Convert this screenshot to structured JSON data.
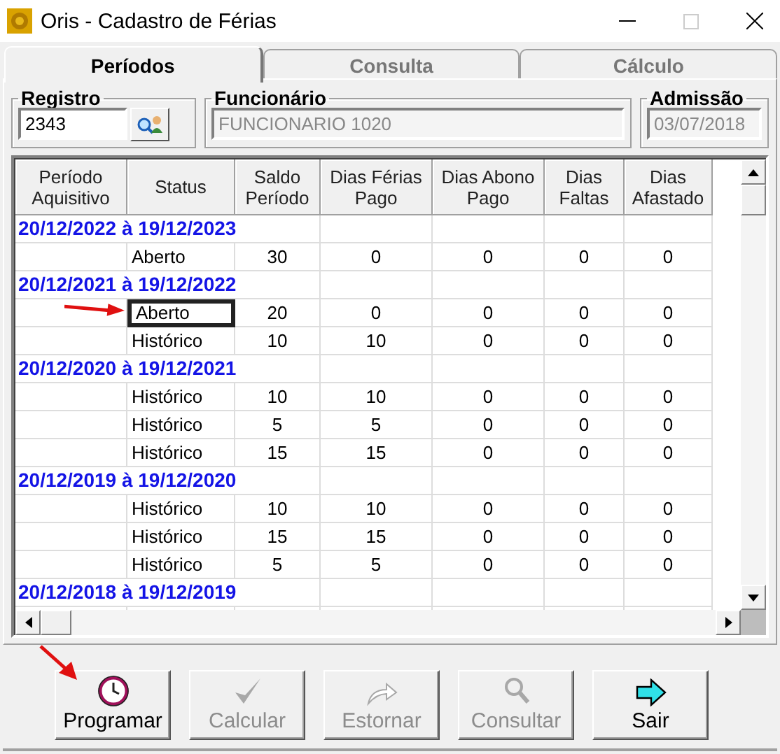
{
  "window": {
    "title": "Oris - Cadastro de Férias"
  },
  "tabs": [
    {
      "label": "Períodos",
      "selected": true
    },
    {
      "label": "Consulta",
      "selected": false
    },
    {
      "label": "Cálculo",
      "selected": false
    }
  ],
  "fields": [
    {
      "label": "Registro",
      "value": "2343",
      "disabled": false
    },
    {
      "label": "Funcionário",
      "value": "FUNCIONARIO 1020",
      "disabled": true
    },
    {
      "label": "Admissão",
      "value": "03/07/2018",
      "disabled": true
    }
  ],
  "table": {
    "columns": [
      "Período Aquisitivo",
      "Status",
      "Saldo Período",
      "Dias Férias Pago",
      "Dias Abono Pago",
      "Dias Faltas",
      "Dias Afastado"
    ],
    "rows": [
      {
        "kind": "group",
        "period": "20/12/2022 à 19/12/2023"
      },
      {
        "kind": "data",
        "selected": false,
        "cells": [
          "Aberto",
          "30",
          "0",
          "0",
          "0",
          "0"
        ]
      },
      {
        "kind": "group",
        "period": "20/12/2021 à 19/12/2022"
      },
      {
        "kind": "data",
        "selected": true,
        "cells": [
          "Aberto",
          "20",
          "0",
          "0",
          "0",
          "0"
        ]
      },
      {
        "kind": "data",
        "selected": false,
        "cells": [
          "Histórico",
          "10",
          "10",
          "0",
          "0",
          "0"
        ]
      },
      {
        "kind": "group",
        "period": "20/12/2020 à 19/12/2021"
      },
      {
        "kind": "data",
        "selected": false,
        "cells": [
          "Histórico",
          "10",
          "10",
          "0",
          "0",
          "0"
        ]
      },
      {
        "kind": "data",
        "selected": false,
        "cells": [
          "Histórico",
          "5",
          "5",
          "0",
          "0",
          "0"
        ]
      },
      {
        "kind": "data",
        "selected": false,
        "cells": [
          "Histórico",
          "15",
          "15",
          "0",
          "0",
          "0"
        ]
      },
      {
        "kind": "group",
        "period": "20/12/2019 à 19/12/2020"
      },
      {
        "kind": "data",
        "selected": false,
        "cells": [
          "Histórico",
          "10",
          "10",
          "0",
          "0",
          "0"
        ]
      },
      {
        "kind": "data",
        "selected": false,
        "cells": [
          "Histórico",
          "15",
          "15",
          "0",
          "0",
          "0"
        ]
      },
      {
        "kind": "data",
        "selected": false,
        "cells": [
          "Histórico",
          "5",
          "5",
          "0",
          "0",
          "0"
        ]
      },
      {
        "kind": "group",
        "period": "20/12/2018 à 19/12/2019"
      }
    ]
  },
  "buttons": [
    {
      "label": "Programar",
      "disabled": false
    },
    {
      "label": "Calcular",
      "disabled": true
    },
    {
      "label": "Estornar",
      "disabled": true
    },
    {
      "label": "Consultar",
      "disabled": true
    },
    {
      "label": "Sair",
      "disabled": false
    }
  ]
}
